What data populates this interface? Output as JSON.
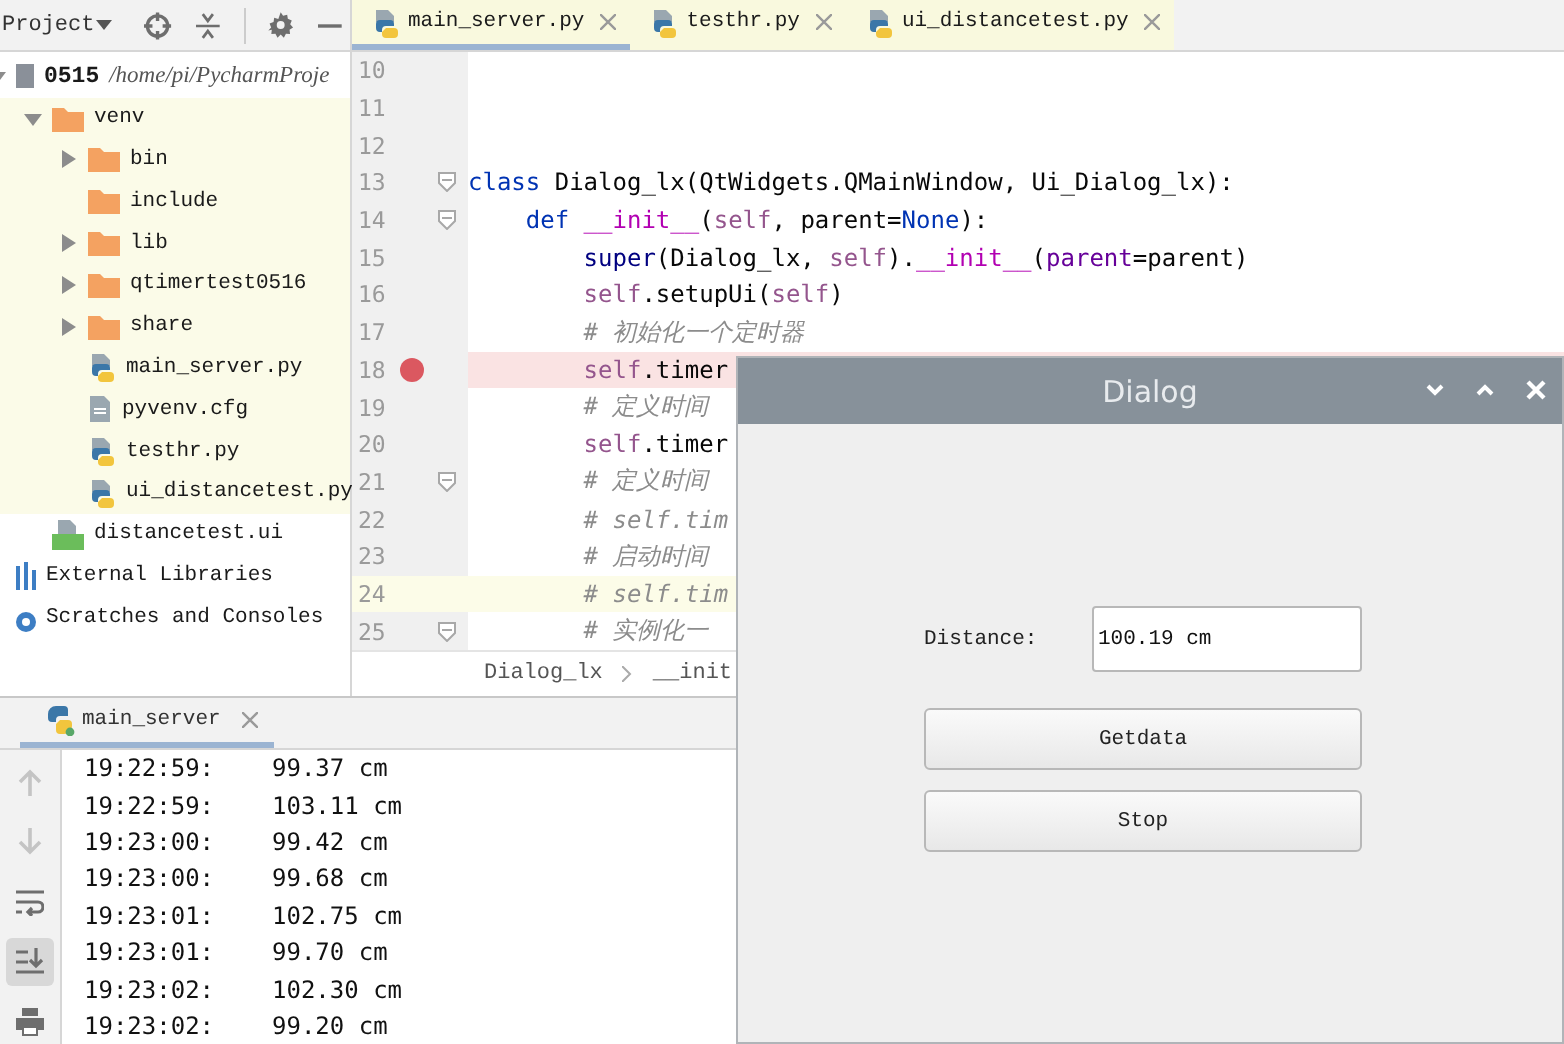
{
  "project_panel": {
    "title": "Project",
    "tree": [
      {
        "label": "0515",
        "path": "/home/pi/PycharmProje",
        "kind": "module",
        "expanded": true,
        "children": [
          {
            "label": "venv",
            "kind": "folder",
            "expanded": true,
            "tinted": true,
            "children": [
              {
                "label": "bin",
                "kind": "folder",
                "expanded": false
              },
              {
                "label": "include",
                "kind": "folder"
              },
              {
                "label": "lib",
                "kind": "folder",
                "expanded": false
              },
              {
                "label": "qtimertest0516",
                "kind": "folder",
                "expanded": false
              },
              {
                "label": "share",
                "kind": "folder",
                "expanded": false
              },
              {
                "label": "main_server.py",
                "kind": "python"
              },
              {
                "label": "pyvenv.cfg",
                "kind": "text"
              },
              {
                "label": "testhr.py",
                "kind": "python"
              },
              {
                "label": "ui_distancetest.py",
                "kind": "python"
              }
            ]
          },
          {
            "label": "distancetest.ui",
            "kind": "qt"
          }
        ]
      },
      {
        "label": "External Libraries",
        "kind": "libraries"
      },
      {
        "label": "Scratches and Consoles",
        "kind": "scratches"
      }
    ]
  },
  "editor": {
    "tabs": [
      {
        "label": "main_server.py",
        "selected": true
      },
      {
        "label": "testhr.py",
        "selected": false
      },
      {
        "label": "ui_distancetest.py",
        "selected": false
      }
    ],
    "lines": [
      {
        "number": "10",
        "breakpoint": false,
        "current": false,
        "fold": false
      },
      {
        "number": "11",
        "breakpoint": false,
        "current": false,
        "fold": false
      },
      {
        "number": "12",
        "breakpoint": false,
        "current": false,
        "fold": false
      },
      {
        "number": "13",
        "breakpoint": false,
        "current": false,
        "fold": true,
        "tokens": [
          {
            "kind": "keyword",
            "text": "class"
          },
          {
            "kind": "plain",
            "text": " Dialog_lx(QtWidgets.QMainWindow, Ui_Dialog_lx):"
          }
        ]
      },
      {
        "number": "14",
        "breakpoint": false,
        "current": false,
        "fold": true,
        "tokens": [
          {
            "kind": "keyword",
            "text": "    def"
          },
          {
            "kind": "magic",
            "text": " __init__"
          },
          {
            "kind": "plain",
            "text": "("
          },
          {
            "kind": "self",
            "text": "self"
          },
          {
            "kind": "plain",
            "text": ", parent="
          },
          {
            "kind": "keyword",
            "text": "None"
          },
          {
            "kind": "plain",
            "text": "):"
          }
        ]
      },
      {
        "number": "15",
        "breakpoint": false,
        "current": false,
        "fold": false,
        "tokens": [
          {
            "kind": "builtin",
            "text": "        super"
          },
          {
            "kind": "plain",
            "text": "(Dialog_lx, "
          },
          {
            "kind": "self",
            "text": "self"
          },
          {
            "kind": "plain",
            "text": ")."
          },
          {
            "kind": "magic",
            "text": "__init__"
          },
          {
            "kind": "plain",
            "text": "("
          },
          {
            "kind": "param",
            "text": "parent"
          },
          {
            "kind": "plain",
            "text": "=parent)"
          }
        ]
      },
      {
        "number": "16",
        "breakpoint": false,
        "current": false,
        "fold": false,
        "tokens": [
          {
            "kind": "self",
            "text": "        self"
          },
          {
            "kind": "plain",
            "text": ".setupUi("
          },
          {
            "kind": "self",
            "text": "self"
          },
          {
            "kind": "plain",
            "text": ")"
          }
        ]
      },
      {
        "number": "17",
        "breakpoint": false,
        "current": false,
        "fold": false,
        "tokens": [
          {
            "kind": "comment",
            "text": "        # 初始化一个定时器"
          }
        ]
      },
      {
        "number": "18",
        "breakpoint": true,
        "current": false,
        "fold": false,
        "tokens": [
          {
            "kind": "self",
            "text": "        self"
          },
          {
            "kind": "plain",
            "text": ".timer"
          }
        ]
      },
      {
        "number": "19",
        "breakpoint": false,
        "current": false,
        "fold": false,
        "tokens": [
          {
            "kind": "comment",
            "text": "        # 定义时间"
          }
        ]
      },
      {
        "number": "20",
        "breakpoint": false,
        "current": false,
        "fold": false,
        "tokens": [
          {
            "kind": "self",
            "text": "        self"
          },
          {
            "kind": "plain",
            "text": ".timer"
          }
        ]
      },
      {
        "number": "21",
        "breakpoint": false,
        "current": false,
        "fold": true,
        "tokens": [
          {
            "kind": "comment",
            "text": "        # 定义时间"
          }
        ]
      },
      {
        "number": "22",
        "breakpoint": false,
        "current": false,
        "fold": false,
        "tokens": [
          {
            "kind": "comment",
            "text": "        # self.tim"
          }
        ]
      },
      {
        "number": "23",
        "breakpoint": false,
        "current": false,
        "fold": false,
        "tokens": [
          {
            "kind": "comment",
            "text": "        # 启动时间"
          }
        ]
      },
      {
        "number": "24",
        "breakpoint": false,
        "current": true,
        "fold": false,
        "tokens": [
          {
            "kind": "comment",
            "text": "        # self.tim"
          }
        ]
      },
      {
        "number": "25",
        "breakpoint": false,
        "current": false,
        "fold": true,
        "tokens": [
          {
            "kind": "comment",
            "text": "        # 实例化一"
          }
        ]
      }
    ],
    "breadcrumb": [
      "Dialog_lx",
      "__init"
    ]
  },
  "run_panel": {
    "tab": {
      "label": "main_server",
      "selected": true
    },
    "tools": [
      {
        "kind": "up",
        "disabled": true,
        "selected": false
      },
      {
        "kind": "down",
        "disabled": true,
        "selected": false
      },
      {
        "kind": "wrap",
        "disabled": false,
        "selected": false
      },
      {
        "kind": "scroll-end",
        "disabled": false,
        "selected": true
      },
      {
        "kind": "print",
        "disabled": false,
        "selected": false
      }
    ],
    "output": [
      {
        "time": "19:22:59:",
        "value": "99.37 cm"
      },
      {
        "time": "19:22:59:",
        "value": "103.11 cm"
      },
      {
        "time": "19:23:00:",
        "value": "99.42 cm"
      },
      {
        "time": "19:23:00:",
        "value": "99.68 cm"
      },
      {
        "time": "19:23:01:",
        "value": "102.75 cm"
      },
      {
        "time": "19:23:01:",
        "value": "99.70 cm"
      },
      {
        "time": "19:23:02:",
        "value": "102.30 cm"
      },
      {
        "time": "19:23:02:",
        "value": "99.20 cm"
      }
    ]
  },
  "dialog": {
    "title": "Dialog",
    "field_label": "Distance:",
    "field_value": "100.19 cm",
    "buttons": [
      "Getdata",
      "Stop"
    ]
  }
}
